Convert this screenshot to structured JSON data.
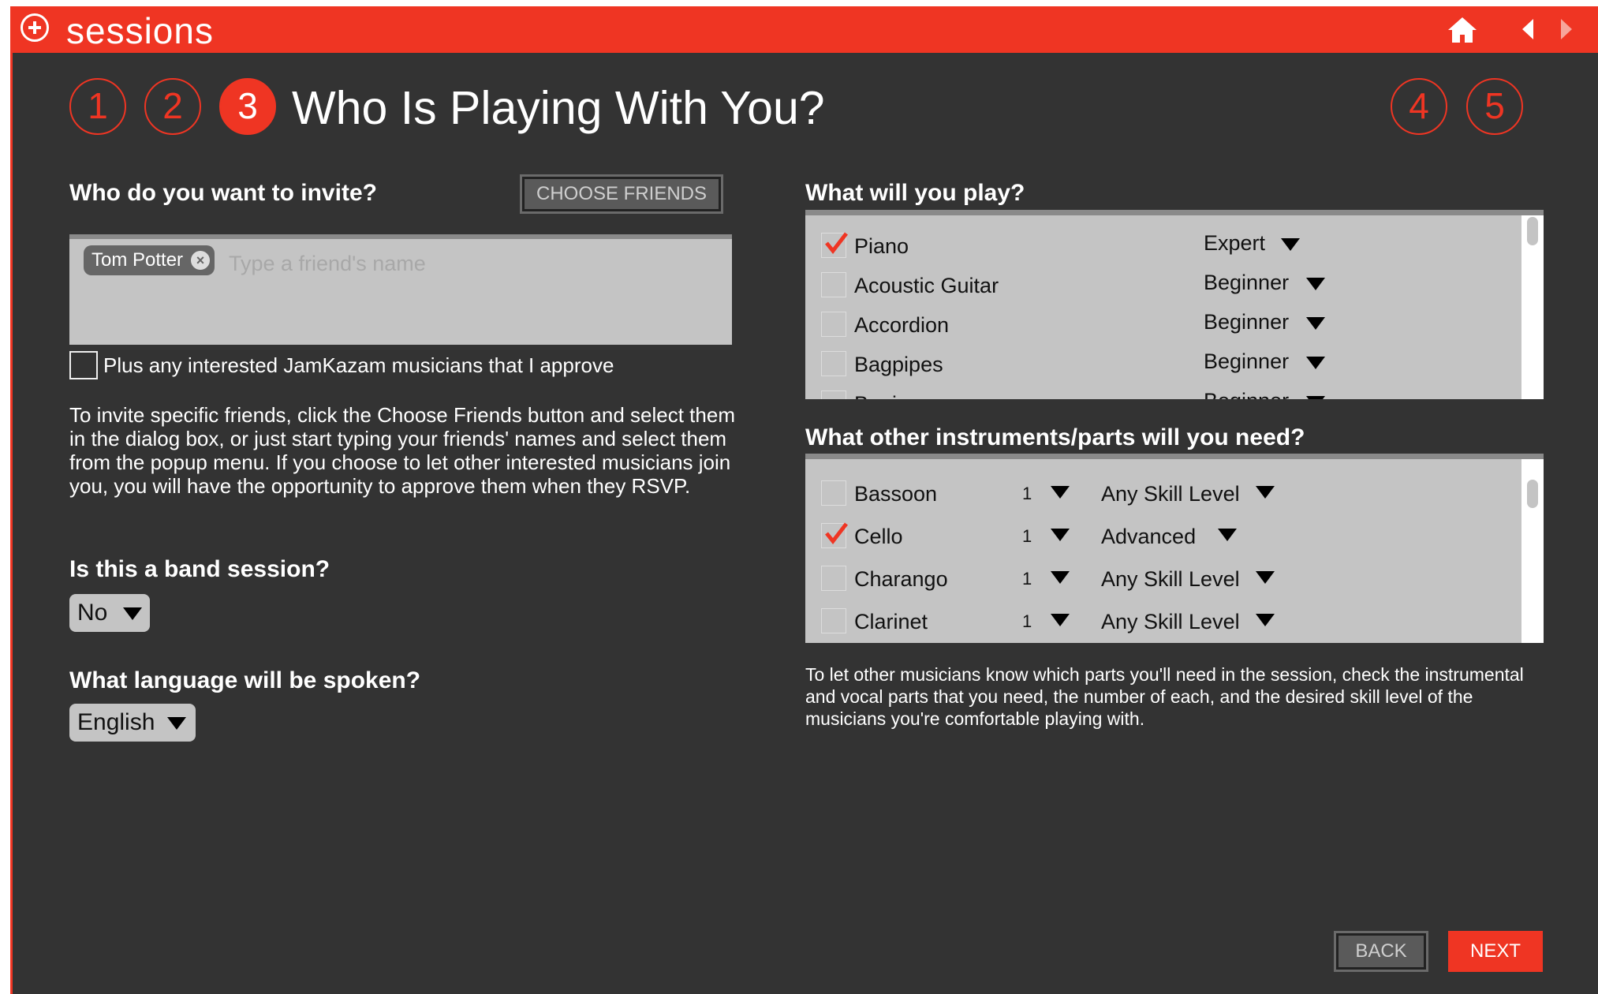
{
  "app": {
    "title": "sessions"
  },
  "nav": {
    "home_icon": "home-icon",
    "back_icon": "left-arrow-icon",
    "forward_icon": "right-arrow-icon"
  },
  "steps": [
    "1",
    "2",
    "3",
    "4",
    "5"
  ],
  "active_step": "3",
  "step_heading": "Who Is Playing With You?",
  "invite": {
    "label": "Who do you want to invite?",
    "choose_button": "CHOOSE FRIENDS",
    "chip": "Tom Potter",
    "chip_close": "×",
    "placeholder": "Type a friend's name",
    "checkbox_label": "Plus any interested JamKazam musicians that I approve",
    "help": "To invite specific friends, click the Choose Friends button and select them in the dialog box, or just start typing your friends' names and select them from the popup menu. If you choose to let other interested musicians join you, you will have the opportunity to approve them when they RSVP."
  },
  "band": {
    "label": "Is this a band session?",
    "value": "No"
  },
  "language": {
    "label": "What language will be spoken?",
    "value": "English"
  },
  "play": {
    "label": "What will you play?",
    "items": [
      {
        "name": "Piano",
        "level": "Expert",
        "checked": true
      },
      {
        "name": "Acoustic Guitar",
        "level": "Beginner",
        "checked": false
      },
      {
        "name": "Accordion",
        "level": "Beginner",
        "checked": false
      },
      {
        "name": "Bagpipes",
        "level": "Beginner",
        "checked": false
      },
      {
        "name": "Banjo",
        "level": "Beginner",
        "checked": false
      }
    ]
  },
  "need": {
    "label": "What other instruments/parts will you need?",
    "items": [
      {
        "name": "Bassoon",
        "count": "1",
        "level": "Any Skill Level",
        "checked": false
      },
      {
        "name": "Cello",
        "count": "1",
        "level": "Advanced",
        "checked": true
      },
      {
        "name": "Charango",
        "count": "1",
        "level": "Any Skill Level",
        "checked": false
      },
      {
        "name": "Clarinet",
        "count": "1",
        "level": "Any Skill Level",
        "checked": false
      }
    ],
    "help": "To let other musicians know which parts you'll need in the session, check the instrumental and vocal parts that you need, the number of each, and the desired skill level of the musicians you're comfortable playing with."
  },
  "footer": {
    "back": "BACK",
    "next": "NEXT"
  },
  "colors": {
    "accent": "#ef3523",
    "panel": "#333333",
    "field": "#c4c4c4"
  }
}
